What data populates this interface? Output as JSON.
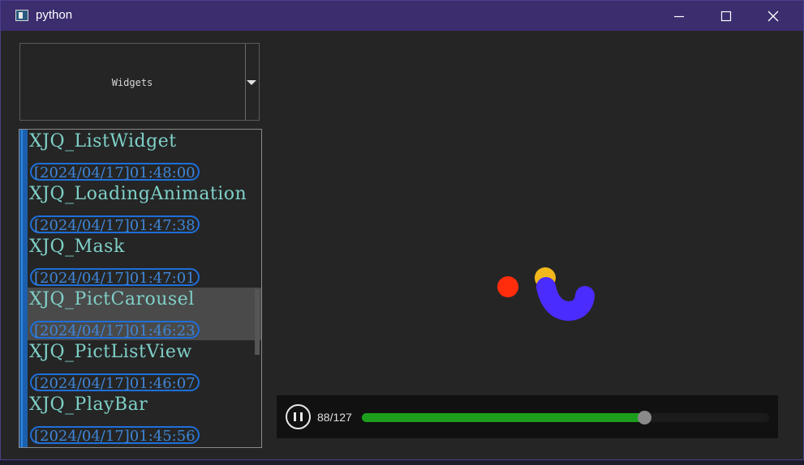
{
  "window": {
    "title": "python",
    "controls": [
      "minimize",
      "maximize",
      "close"
    ]
  },
  "combo": {
    "selected": "Widgets"
  },
  "list": {
    "selected_index": 3,
    "items": [
      {
        "title": "XJQ_ListWidget",
        "time": "[2024/04/17]01:48:00"
      },
      {
        "title": "XJQ_LoadingAnimation",
        "time": "[2024/04/17]01:47:38"
      },
      {
        "title": "XJQ_Mask",
        "time": "[2024/04/17]01:47:01"
      },
      {
        "title": "XJQ_PictCarousel",
        "time": "[2024/04/17]01:46:23"
      },
      {
        "title": "XJQ_PictListView",
        "time": "[2024/04/17]01:46:07"
      },
      {
        "title": "XJQ_PlayBar",
        "time": "[2024/04/17]01:45:56"
      }
    ]
  },
  "animation": {
    "colors": {
      "red": "#ff2d0c",
      "yellow": "#f2b81c",
      "blue": "#4b2cff"
    }
  },
  "playbar": {
    "state": "playing",
    "icon": "pause-icon",
    "frame_text": "88/127",
    "current": 88,
    "total": 127,
    "colors": {
      "fill": "#1c9e1c",
      "knob": "#8a8a8a"
    }
  }
}
